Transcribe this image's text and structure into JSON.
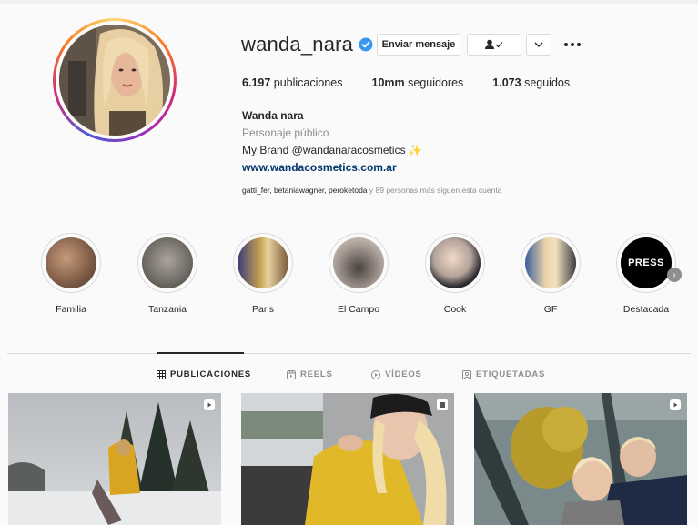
{
  "profile": {
    "username": "wanda_nara",
    "send_message_label": "Enviar mensaje",
    "stats": {
      "posts": "6.197",
      "posts_label": "publicaciones",
      "followers": "10mm",
      "followers_label": "seguidores",
      "following": "1.073",
      "following_label": "seguidos"
    },
    "bio": {
      "name": "Wanda nara",
      "category": "Personaje público",
      "line": "My Brand @wandanaracosmetics ✨",
      "link": "www.wandacosmetics.com.ar"
    },
    "followed_by": {
      "users": "gatti_fer, betaniawagner, peroketoda",
      "rest": " y 89 personas más siguen esta cuenta"
    }
  },
  "highlights": [
    {
      "label": "Familia"
    },
    {
      "label": "Tanzania"
    },
    {
      "label": "Paris"
    },
    {
      "label": "El Campo"
    },
    {
      "label": "Cook"
    },
    {
      "label": "GF"
    },
    {
      "label": "Destacada",
      "cover_text": "PRESS"
    }
  ],
  "tabs": [
    {
      "label": "PUBLICACIONES",
      "active": true
    },
    {
      "label": "REELS"
    },
    {
      "label": "VÍDEOS"
    },
    {
      "label": "ETIQUETADAS"
    }
  ],
  "icons": {
    "verified": "verified-badge-icon",
    "follow": "person-check-icon",
    "chevron": "chevron-down-icon",
    "more": "more-options-icon",
    "reel": "reel-icon"
  },
  "colors": {
    "verified_blue": "#3897f0",
    "link": "#00376b",
    "muted": "#8e8e8e",
    "border": "#dbdbdb"
  }
}
